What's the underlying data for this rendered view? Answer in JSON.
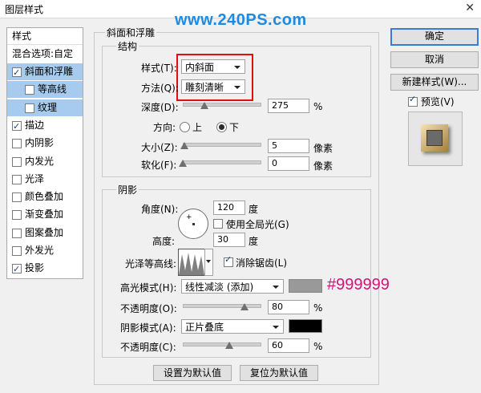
{
  "window": {
    "title": "图层样式",
    "close_glyph": "✕"
  },
  "watermark": "www.240PS.com",
  "sidebar": {
    "header": "样式",
    "blend_options": "混合选项:自定",
    "items": [
      {
        "label": "斜面和浮雕",
        "checked": true
      },
      {
        "label": "等高线",
        "checked": false
      },
      {
        "label": "纹理",
        "checked": false
      },
      {
        "label": "描边",
        "checked": true
      },
      {
        "label": "内阴影",
        "checked": false
      },
      {
        "label": "内发光",
        "checked": false
      },
      {
        "label": "光泽",
        "checked": false
      },
      {
        "label": "颜色叠加",
        "checked": false
      },
      {
        "label": "渐变叠加",
        "checked": false
      },
      {
        "label": "图案叠加",
        "checked": false
      },
      {
        "label": "外发光",
        "checked": false
      },
      {
        "label": "投影",
        "checked": true
      }
    ]
  },
  "bevel": {
    "group_title": "斜面和浮雕",
    "structure_title": "结构",
    "style_label": "样式(T):",
    "style_value": "内斜面",
    "technique_label": "方法(Q):",
    "technique_value": "雕刻清晰",
    "depth_label": "深度(D):",
    "depth_value": "275",
    "depth_fraction": 0.28,
    "percent": "%",
    "direction_label": "方向:",
    "direction_up": "上",
    "direction_down": "下",
    "size_label": "大小(Z):",
    "size_value": "5",
    "size_fraction": 0.02,
    "soften_label": "软化(F):",
    "soften_value": "0",
    "soften_fraction": 0.0,
    "px": "像素"
  },
  "shading": {
    "title": "阴影",
    "angle_label": "角度(N):",
    "angle_value": "120",
    "degree": "度",
    "global_light_label": "使用全局光(G)",
    "altitude_label": "高度:",
    "altitude_value": "30",
    "gloss_label": "光泽等高线:",
    "antialias_label": "消除锯齿(L)",
    "highlight_mode_label": "高光模式(H):",
    "highlight_mode_value": "线性减淡 (添加)",
    "highlight_color": "#999999",
    "highlight_annotation": "#999999",
    "opacity_label": "不透明度(O):",
    "opacity_value": "80",
    "opacity_fraction": 0.8,
    "shadow_mode_label": "阴影模式(A):",
    "shadow_mode_value": "正片叠底",
    "shadow_color": "#000000",
    "shadow_opacity_label": "不透明度(C):",
    "shadow_opacity_value": "60",
    "shadow_opacity_fraction": 0.6,
    "percent": "%"
  },
  "footer": {
    "make_default": "设置为默认值",
    "reset_default": "复位为默认值"
  },
  "right": {
    "ok": "确定",
    "cancel": "取消",
    "new_style": "新建样式(W)...",
    "preview_label": "预览(V)"
  },
  "colors": {
    "highlight_sidebar": "#a6cbef",
    "annotation": "#d0157a",
    "watermark": "#1e8ae0"
  }
}
